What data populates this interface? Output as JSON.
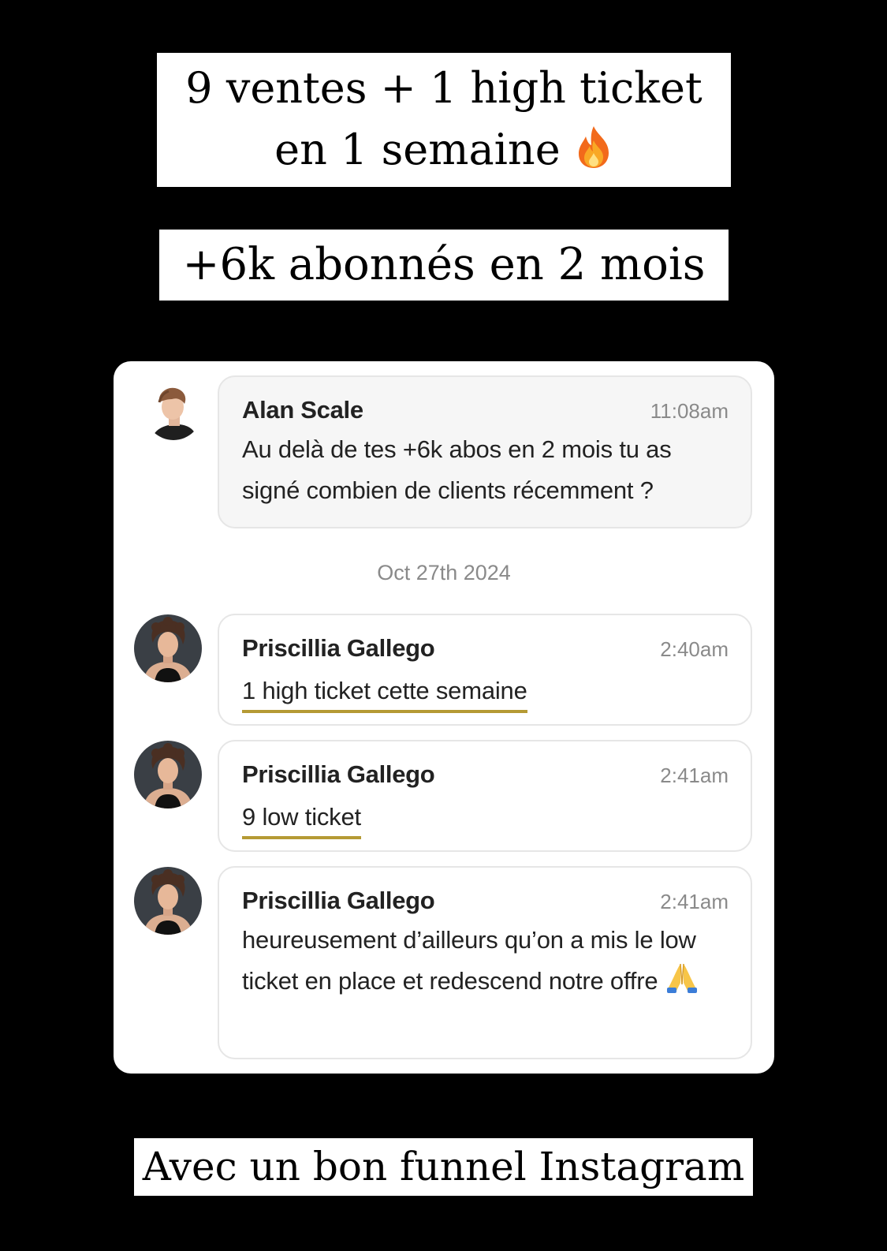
{
  "captions": {
    "headline_line1": "9 ventes + 1 high ticket",
    "headline_line2": "en 1 semaine",
    "headline_emoji": "fire-emoji",
    "subheadline": "+6k abonnés en 2 mois",
    "footer": "Avec un bon funnel Instagram"
  },
  "chat": {
    "date_separator": "Oct 27th 2024",
    "messages": [
      {
        "sender": "Alan Scale",
        "time": "11:08am",
        "text": "Au delà de tes +6k abos en 2 mois tu as signé combien de clients récemment ?"
      },
      {
        "sender": "Priscillia Gallego",
        "time": "2:40am",
        "text": "1 high ticket cette semaine"
      },
      {
        "sender": "Priscillia Gallego",
        "time": "2:41am",
        "text": "9 low ticket"
      },
      {
        "sender": "Priscillia Gallego",
        "time": "2:41am",
        "text": "heureusement d’ailleurs qu’on a mis le low ticket en place et redescend notre offre",
        "emoji": "folded-hands-emoji"
      }
    ]
  },
  "colors": {
    "background": "#000000",
    "highlight_underline": "#b59a34",
    "bubble_gray": "#f6f6f6"
  }
}
